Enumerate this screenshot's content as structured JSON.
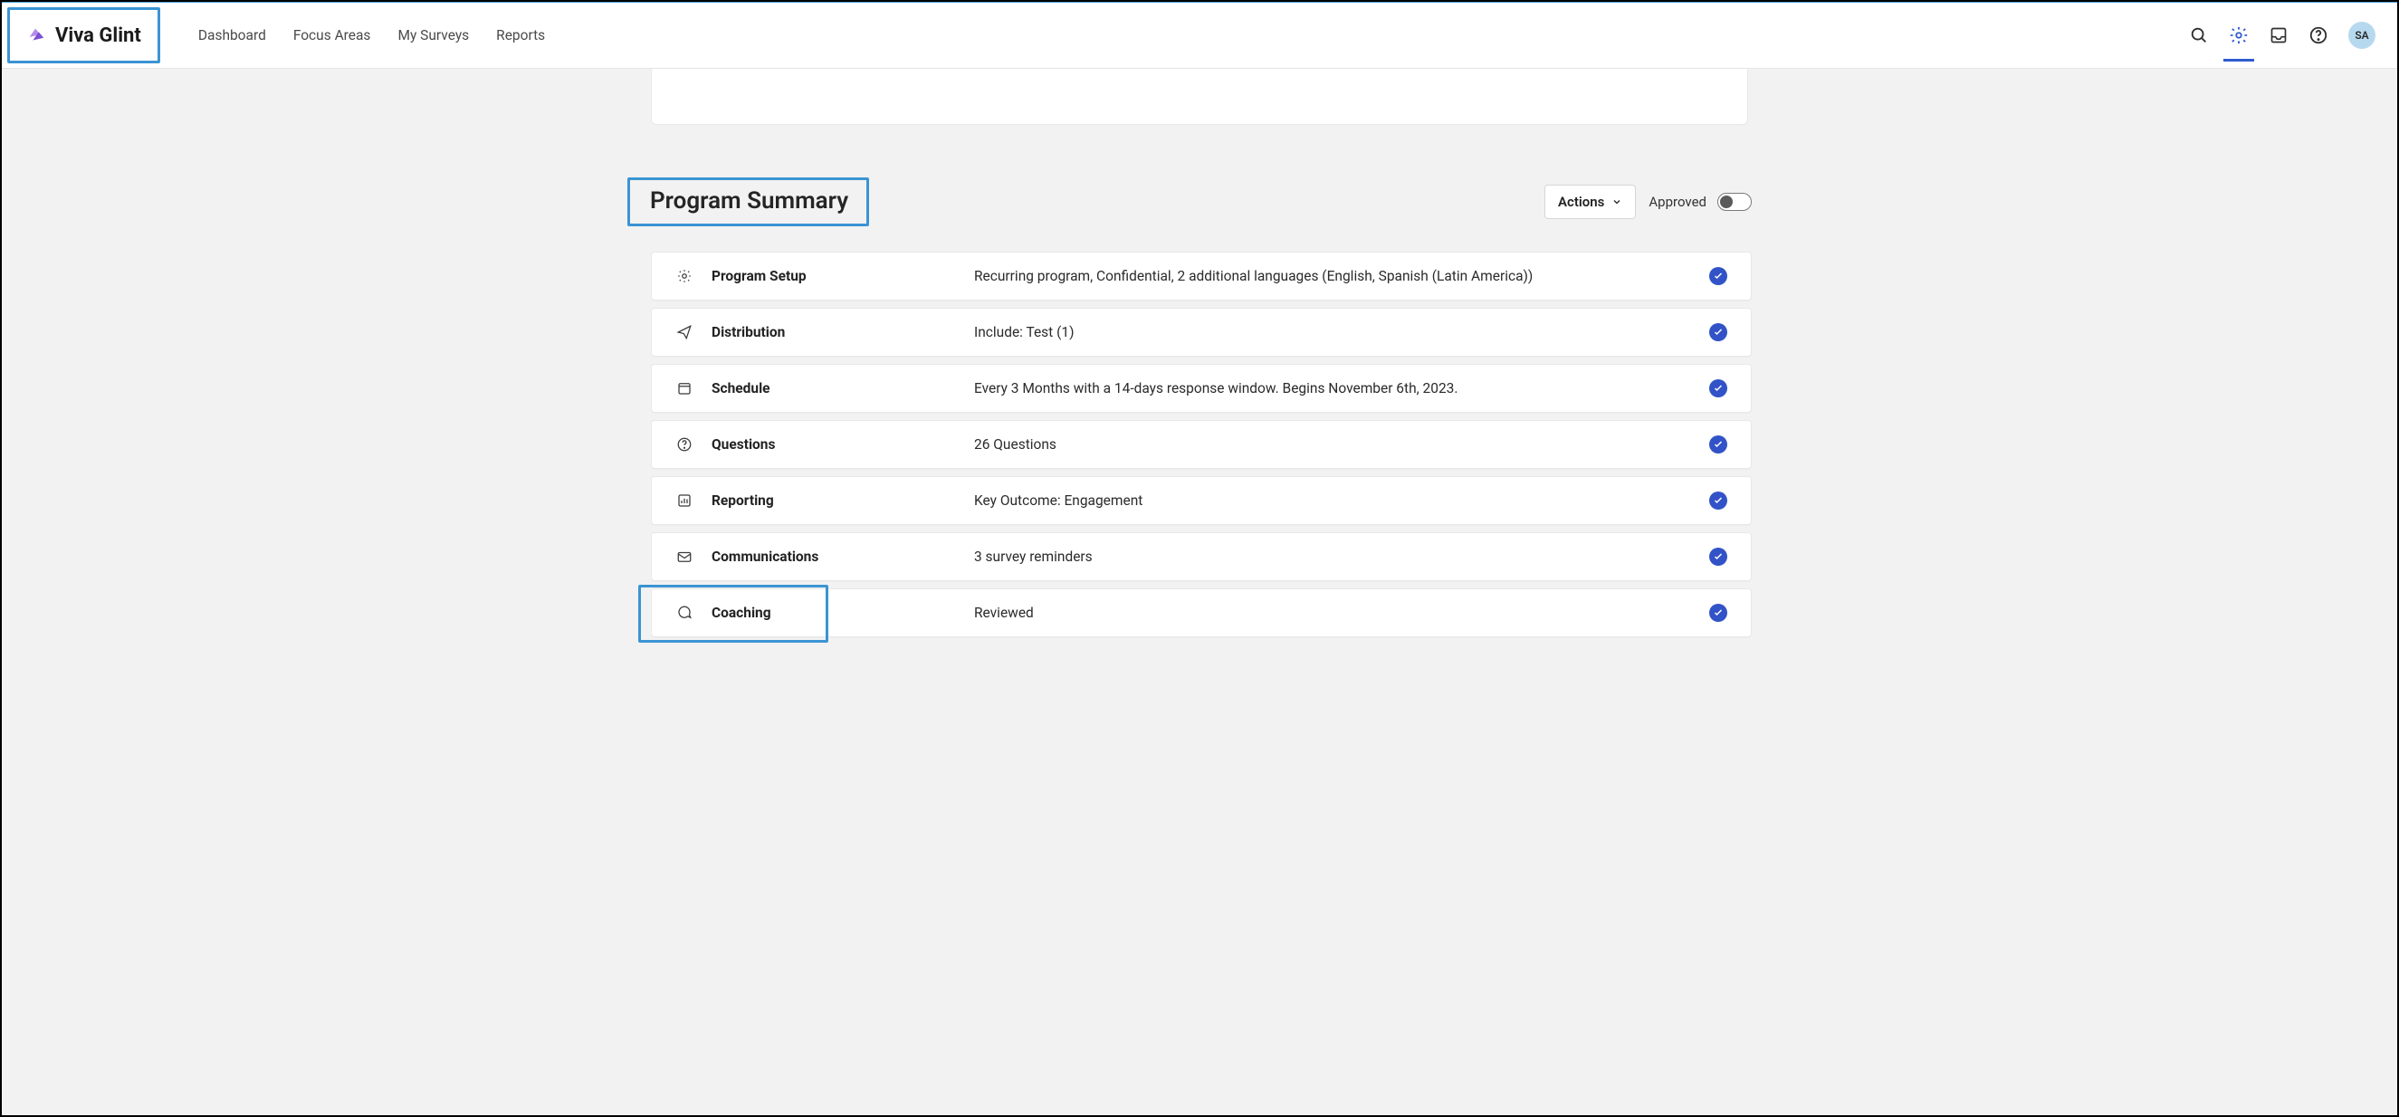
{
  "brand": {
    "name": "Viva Glint"
  },
  "nav": {
    "items": [
      {
        "label": "Dashboard"
      },
      {
        "label": "Focus Areas"
      },
      {
        "label": "My Surveys"
      },
      {
        "label": "Reports"
      }
    ]
  },
  "avatar": {
    "initials": "SA"
  },
  "summary": {
    "title": "Program Summary",
    "actions_label": "Actions",
    "approved_label": "Approved",
    "approved_on": false,
    "rows": [
      {
        "icon": "gear",
        "title": "Program Setup",
        "detail": "Recurring program, Confidential, 2 additional languages (English, Spanish (Latin America))"
      },
      {
        "icon": "send",
        "title": "Distribution",
        "detail": "Include: Test (1)"
      },
      {
        "icon": "calendar",
        "title": "Schedule",
        "detail": "Every 3 Months with a 14-days response window. Begins November 6th, 2023."
      },
      {
        "icon": "question",
        "title": "Questions",
        "detail": "26 Questions"
      },
      {
        "icon": "chart",
        "title": "Reporting",
        "detail": "Key Outcome: Engagement"
      },
      {
        "icon": "mail",
        "title": "Communications",
        "detail": "3 survey reminders"
      },
      {
        "icon": "chat",
        "title": "Coaching",
        "detail": "Reviewed"
      }
    ]
  }
}
